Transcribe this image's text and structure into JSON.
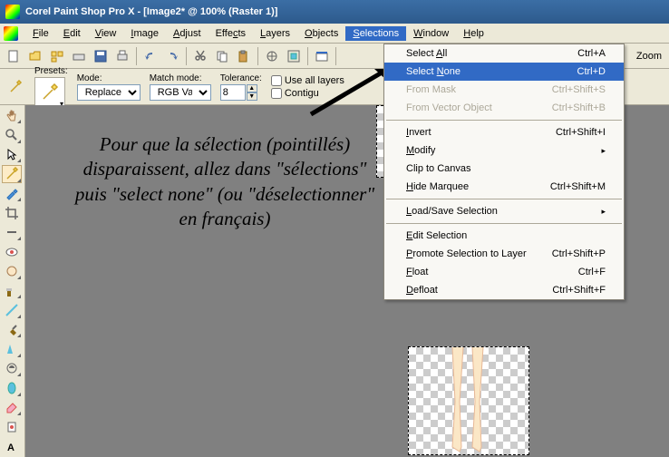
{
  "titlebar": {
    "text": "Corel Paint Shop Pro X - [Image2* @ 100% (Raster 1)]"
  },
  "menubar": {
    "items": [
      {
        "label": "File",
        "u": "F"
      },
      {
        "label": "Edit",
        "u": "E"
      },
      {
        "label": "View",
        "u": "V"
      },
      {
        "label": "Image",
        "u": "I"
      },
      {
        "label": "Adjust",
        "u": "A"
      },
      {
        "label": "Effects",
        "u": "c"
      },
      {
        "label": "Layers",
        "u": "L"
      },
      {
        "label": "Objects",
        "u": "O"
      },
      {
        "label": "Selections",
        "u": "S"
      },
      {
        "label": "Window",
        "u": "W"
      },
      {
        "label": "Help",
        "u": "H"
      }
    ]
  },
  "toolbar": {
    "zoom": "Zoom"
  },
  "options": {
    "presets_label": "Presets:",
    "mode_label": "Mode:",
    "mode_value": "Replace",
    "match_label": "Match mode:",
    "match_value": "RGB Value",
    "tolerance_label": "Tolerance:",
    "tolerance_value": "8",
    "use_all_layers": "Use all layers",
    "contiguous": "Contigu"
  },
  "dropdown": {
    "items": [
      {
        "label": "Select All",
        "u": "A",
        "shortcut": "Ctrl+A"
      },
      {
        "label": "Select None",
        "u": "N",
        "shortcut": "Ctrl+D",
        "highlight": true
      },
      {
        "label": "From Mask",
        "shortcut": "Ctrl+Shift+S",
        "disabled": true
      },
      {
        "label": "From Vector Object",
        "shortcut": "Ctrl+Shift+B",
        "disabled": true
      },
      {
        "sep": true
      },
      {
        "label": "Invert",
        "u": "I",
        "shortcut": "Ctrl+Shift+I"
      },
      {
        "label": "Modify",
        "u": "M",
        "submenu": true
      },
      {
        "label": "Clip to Canvas"
      },
      {
        "label": "Hide Marquee",
        "u": "H",
        "shortcut": "Ctrl+Shift+M"
      },
      {
        "sep": true
      },
      {
        "label": "Load/Save Selection",
        "u": "L",
        "submenu": true
      },
      {
        "sep": true
      },
      {
        "label": "Edit Selection",
        "u": "E"
      },
      {
        "label": "Promote Selection to Layer",
        "u": "P",
        "shortcut": "Ctrl+Shift+P"
      },
      {
        "label": "Float",
        "u": "F",
        "shortcut": "Ctrl+F"
      },
      {
        "label": "Defloat",
        "u": "D",
        "shortcut": "Ctrl+Shift+F"
      }
    ]
  },
  "annotation": {
    "text": "Pour que la sélection (pointillés) disparaissent, allez dans \"sélections\" puis \"select none\" (ou \"déselectionner\" en français)"
  }
}
